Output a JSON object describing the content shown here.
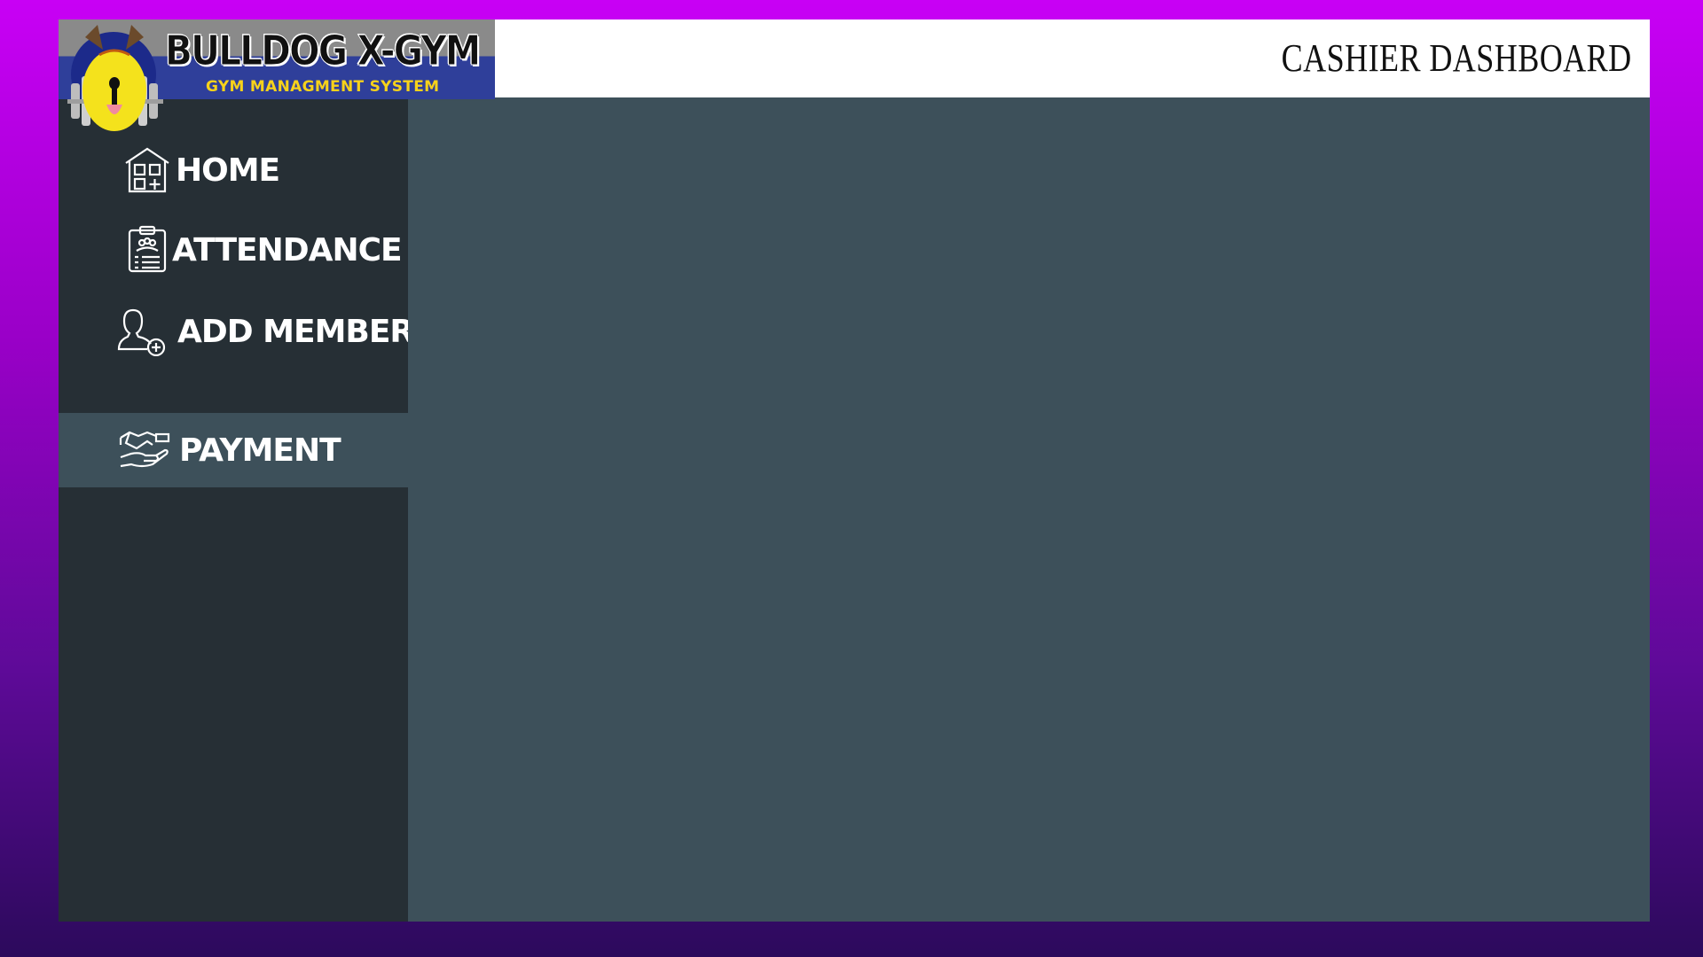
{
  "app": {
    "logo_title": "BULLDOG X-GYM",
    "logo_subtitle": "GYM MANAGMENT SYSTEM"
  },
  "header": {
    "title": "CASHIER DASHBOARD"
  },
  "sidebar": {
    "items": [
      {
        "label": "HOME",
        "icon": "home-icon",
        "active": false
      },
      {
        "label": "ATTENDANCE",
        "icon": "clipboard-icon",
        "active": false
      },
      {
        "label": "ADD MEMBER",
        "icon": "add-user-icon",
        "active": false
      },
      {
        "label": "PAYMENT",
        "icon": "handshake-icon",
        "active": true
      }
    ]
  },
  "colors": {
    "background_top": "#c800f5",
    "background_bottom": "#2c0a5c",
    "sidebar": "#262f35",
    "content": "#3d505a",
    "active_item": "#3d505a",
    "logo_subtitle": "#f7d21a"
  }
}
